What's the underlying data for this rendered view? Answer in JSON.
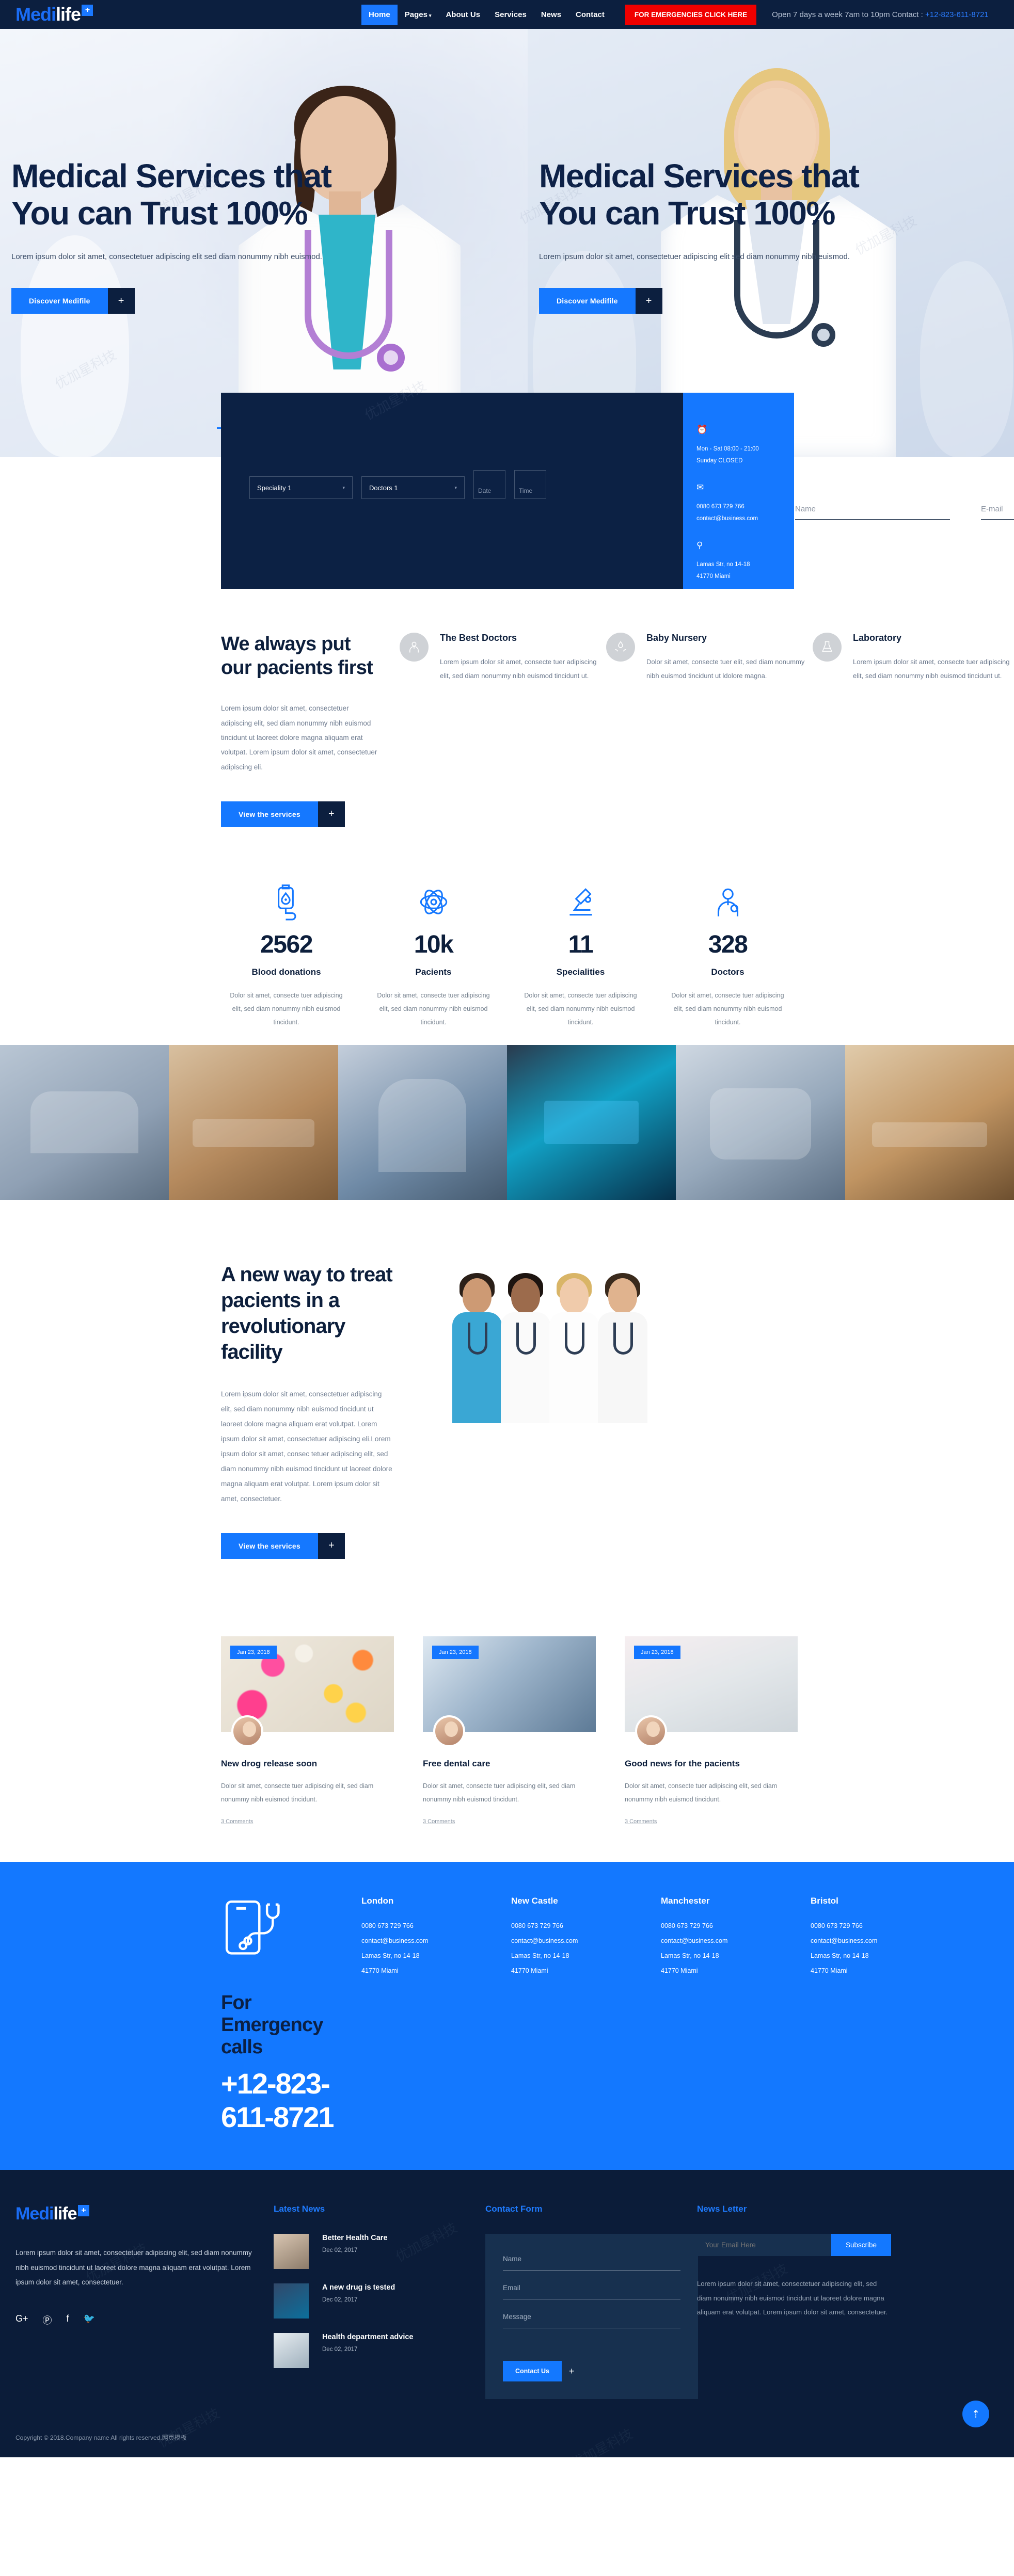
{
  "brand": {
    "part1": "Medi",
    "part2": "life",
    "badge": "+"
  },
  "colors": {
    "accent": "#1578ff",
    "dark": "#0c1f3f",
    "emergency_red": "#f00000"
  },
  "topbar": {
    "nav": [
      {
        "label": "Home",
        "active": true
      },
      {
        "label": "Pages",
        "caret": "▾"
      },
      {
        "label": "About Us"
      },
      {
        "label": "Services"
      },
      {
        "label": "News"
      },
      {
        "label": "Contact"
      }
    ],
    "emergency_button": "FOR EMERGENCIES CLICK HERE",
    "hours_text": "Open 7 days a week 7am to 10pm Contact : ",
    "hours_phone": "+12-823-611-8721"
  },
  "hero": {
    "slides": [
      {
        "title": "Medical Services that You can Trust 100%",
        "subtitle": "Lorem ipsum dolor sit amet, consectetuer adipiscing elit sed diam nonummy nibh euismod.",
        "button": "Discover Medifile",
        "button_plus": "+"
      },
      {
        "title": "Medical Services that You can Trust 100%",
        "subtitle": "Lorem ipsum dolor sit amet, consectetuer adipiscing elit sed diam nonummy nibh euismod.",
        "button": "Discover Medifile",
        "button_plus": "+"
      }
    ]
  },
  "appointment": {
    "speciality_selected": "Speciality 1",
    "doctors_selected": "Doctors 1",
    "date_placeholder": "Date",
    "time_placeholder": "Time",
    "name_placeholder": "Name",
    "email_placeholder": "E-mail",
    "info": {
      "clock_icon": "alarm-clock-icon",
      "hours_line1": "Mon - Sat 08:00 - 21:00",
      "hours_line2": "Sunday CLOSED",
      "mail_icon": "envelope-icon",
      "phone": "0080 673 729 766",
      "email": "contact@business.com",
      "pin_icon": "map-pin-icon",
      "address_line1": "Lamas Str, no 14-18",
      "address_line2": "41770 Miami"
    }
  },
  "services": {
    "heading": "We always put our pacients first",
    "body": "Lorem ipsum dolor sit amet, consectetuer adipiscing elit, sed diam nonummy nibh euismod tincidunt ut laoreet dolore magna aliquam erat volutpat. Lorem ipsum dolor sit amet, consectetuer adipiscing eli.",
    "button": "View the services",
    "button_plus": "+",
    "items": [
      {
        "icon": "doctor-icon",
        "title": "The Best Doctors",
        "text": "Lorem ipsum dolor sit amet, consecte tuer adipiscing elit, sed diam nonummy nibh euismod tincidunt ut."
      },
      {
        "icon": "baby-hands-icon",
        "title": "Baby Nursery",
        "text": "Dolor sit amet, consecte tuer elit, sed diam nonummy nibh euismod tincidunt ut ldolore magna."
      },
      {
        "icon": "flask-icon",
        "title": "Laboratory",
        "text": "Lorem ipsum dolor sit amet, consecte tuer adipiscing elit, sed diam nonummy nibh euismod tincidunt ut."
      }
    ]
  },
  "stats": [
    {
      "icon": "blood-bag-icon",
      "number": "2562",
      "label": "Blood donations",
      "text": "Dolor sit amet, consecte tuer adipiscing elit, sed diam nonummy nibh euismod tincidunt."
    },
    {
      "icon": "atom-icon",
      "number": "10k",
      "label": "Pacients",
      "text": "Dolor sit amet, consecte tuer adipiscing elit, sed diam nonummy nibh euismod tincidunt."
    },
    {
      "icon": "microscope-icon",
      "number": "11",
      "label": "Specialities",
      "text": "Dolor sit amet, consecte tuer adipiscing elit, sed diam nonummy nibh euismod tincidunt."
    },
    {
      "icon": "doctor-badge-icon",
      "number": "328",
      "label": "Doctors",
      "text": "Dolor sit amet, consecte tuer adipiscing elit, sed diam nonummy nibh euismod tincidunt."
    }
  ],
  "revolution": {
    "heading": "A new way to treat pacients in a revolutionary facility",
    "body": "Lorem ipsum dolor sit amet, consectetuer adipiscing elit, sed diam nonummy nibh euismod tincidunt ut laoreet dolore magna aliquam erat volutpat. Lorem ipsum dolor sit amet, consectetuer adipiscing eli.Lorem ipsum dolor sit amet, consec tetuer adipiscing elit, sed diam nonummy nibh euismod tincidunt ut laoreet dolore magna aliquam erat volutpat. Lorem ipsum dolor sit amet, consectetuer.",
    "button": "View the services",
    "button_plus": "+"
  },
  "blog": [
    {
      "date": "Jan 23, 2018",
      "title": "New drog release soon",
      "text": "Dolor sit amet, consecte tuer adipiscing elit, sed diam nonummy nibh euismod tincidunt.",
      "comments": "3 Comments"
    },
    {
      "date": "Jan 23, 2018",
      "title": "Free dental care",
      "text": "Dolor sit amet, consecte tuer adipiscing elit, sed diam nonummy nibh euismod tincidunt.",
      "comments": "3 Comments"
    },
    {
      "date": "Jan 23, 2018",
      "title": "Good news for the pacients",
      "text": "Dolor sit amet, consecte tuer adipiscing elit, sed diam nonummy nibh euismod tincidunt.",
      "comments": "3 Comments"
    }
  ],
  "emergency": {
    "icon": "phone-stethoscope-icon",
    "heading": "For Emergency calls",
    "phone": "+12-823-611-8721",
    "offices": [
      {
        "city": "London",
        "phone": "0080 673 729 766",
        "email": "contact@business.com",
        "address1": "Lamas Str, no 14-18",
        "address2": "41770 Miami"
      },
      {
        "city": "New Castle",
        "phone": "0080 673 729 766",
        "email": "contact@business.com",
        "address1": "Lamas Str, no 14-18",
        "address2": "41770 Miami"
      },
      {
        "city": "Manchester",
        "phone": "0080 673 729 766",
        "email": "contact@business.com",
        "address1": "Lamas Str, no 14-18",
        "address2": "41770 Miami"
      },
      {
        "city": "Bristol",
        "phone": "0080 673 729 766",
        "email": "contact@business.com",
        "address1": "Lamas Str, no 14-18",
        "address2": "41770 Miami"
      }
    ]
  },
  "footer": {
    "about_text": "Lorem ipsum dolor sit amet, consectetuer adipiscing elit, sed diam nonummy nibh euismod tincidunt ut laoreet dolore magna aliquam erat volutpat. Lorem ipsum dolor sit amet, consectetuer.",
    "social": [
      {
        "icon": "google-plus-icon",
        "glyph": "G+"
      },
      {
        "icon": "pinterest-icon",
        "glyph": "Ⓟ"
      },
      {
        "icon": "facebook-icon",
        "glyph": "f"
      },
      {
        "icon": "twitter-icon",
        "glyph": "🐦"
      }
    ],
    "latest_news_title": "Latest News",
    "latest_news": [
      {
        "title": "Better Health Care",
        "date": "Dec 02, 2017"
      },
      {
        "title": "A new drug is tested",
        "date": "Dec 02, 2017"
      },
      {
        "title": "Health department advice",
        "date": "Dec 02, 2017"
      }
    ],
    "contact_form_title": "Contact Form",
    "contact_form": {
      "name_placeholder": "Name",
      "email_placeholder": "Email",
      "message_placeholder": "Message",
      "submit": "Contact Us",
      "submit_plus": "+"
    },
    "newsletter_title": "News Letter",
    "newsletter": {
      "input_placeholder": "Your Email Here",
      "button": "Subscribe",
      "text": "Lorem ipsum dolor sit amet, consectetuer adipiscing elit, sed diam nonummy nibh euismod tincidunt ut laoreet dolore magna aliquam erat volutpat. Lorem ipsum dolor sit amet, consectetuer."
    },
    "copyright": "Copyright © 2018.Company name All rights reserved.网页模板",
    "to_top_icon": "chevron-up-icon"
  },
  "watermark_text": "优加星科技"
}
